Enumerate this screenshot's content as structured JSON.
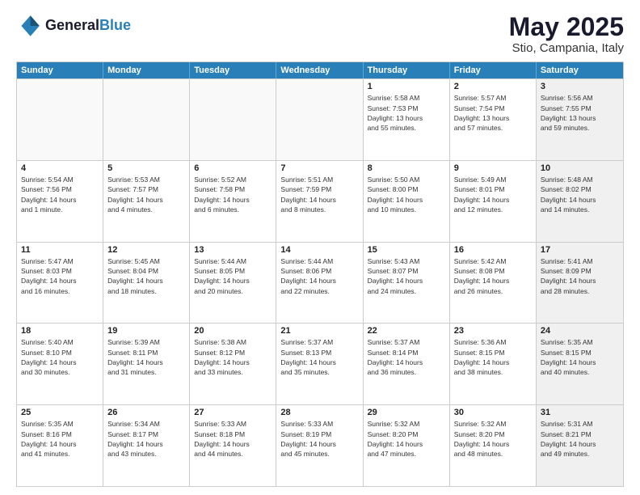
{
  "logo": {
    "line1": "General",
    "line2": "Blue"
  },
  "title": "May 2025",
  "subtitle": "Stio, Campania, Italy",
  "days": [
    "Sunday",
    "Monday",
    "Tuesday",
    "Wednesday",
    "Thursday",
    "Friday",
    "Saturday"
  ],
  "weeks": [
    [
      {
        "day": "",
        "empty": true
      },
      {
        "day": "",
        "empty": true
      },
      {
        "day": "",
        "empty": true
      },
      {
        "day": "",
        "empty": true
      },
      {
        "day": "1",
        "info": "Sunrise: 5:58 AM\nSunset: 7:53 PM\nDaylight: 13 hours\nand 55 minutes."
      },
      {
        "day": "2",
        "info": "Sunrise: 5:57 AM\nSunset: 7:54 PM\nDaylight: 13 hours\nand 57 minutes."
      },
      {
        "day": "3",
        "info": "Sunrise: 5:56 AM\nSunset: 7:55 PM\nDaylight: 13 hours\nand 59 minutes.",
        "shaded": true
      }
    ],
    [
      {
        "day": "4",
        "info": "Sunrise: 5:54 AM\nSunset: 7:56 PM\nDaylight: 14 hours\nand 1 minute."
      },
      {
        "day": "5",
        "info": "Sunrise: 5:53 AM\nSunset: 7:57 PM\nDaylight: 14 hours\nand 4 minutes."
      },
      {
        "day": "6",
        "info": "Sunrise: 5:52 AM\nSunset: 7:58 PM\nDaylight: 14 hours\nand 6 minutes."
      },
      {
        "day": "7",
        "info": "Sunrise: 5:51 AM\nSunset: 7:59 PM\nDaylight: 14 hours\nand 8 minutes."
      },
      {
        "day": "8",
        "info": "Sunrise: 5:50 AM\nSunset: 8:00 PM\nDaylight: 14 hours\nand 10 minutes."
      },
      {
        "day": "9",
        "info": "Sunrise: 5:49 AM\nSunset: 8:01 PM\nDaylight: 14 hours\nand 12 minutes."
      },
      {
        "day": "10",
        "info": "Sunrise: 5:48 AM\nSunset: 8:02 PM\nDaylight: 14 hours\nand 14 minutes.",
        "shaded": true
      }
    ],
    [
      {
        "day": "11",
        "info": "Sunrise: 5:47 AM\nSunset: 8:03 PM\nDaylight: 14 hours\nand 16 minutes."
      },
      {
        "day": "12",
        "info": "Sunrise: 5:45 AM\nSunset: 8:04 PM\nDaylight: 14 hours\nand 18 minutes."
      },
      {
        "day": "13",
        "info": "Sunrise: 5:44 AM\nSunset: 8:05 PM\nDaylight: 14 hours\nand 20 minutes."
      },
      {
        "day": "14",
        "info": "Sunrise: 5:44 AM\nSunset: 8:06 PM\nDaylight: 14 hours\nand 22 minutes."
      },
      {
        "day": "15",
        "info": "Sunrise: 5:43 AM\nSunset: 8:07 PM\nDaylight: 14 hours\nand 24 minutes."
      },
      {
        "day": "16",
        "info": "Sunrise: 5:42 AM\nSunset: 8:08 PM\nDaylight: 14 hours\nand 26 minutes."
      },
      {
        "day": "17",
        "info": "Sunrise: 5:41 AM\nSunset: 8:09 PM\nDaylight: 14 hours\nand 28 minutes.",
        "shaded": true
      }
    ],
    [
      {
        "day": "18",
        "info": "Sunrise: 5:40 AM\nSunset: 8:10 PM\nDaylight: 14 hours\nand 30 minutes."
      },
      {
        "day": "19",
        "info": "Sunrise: 5:39 AM\nSunset: 8:11 PM\nDaylight: 14 hours\nand 31 minutes."
      },
      {
        "day": "20",
        "info": "Sunrise: 5:38 AM\nSunset: 8:12 PM\nDaylight: 14 hours\nand 33 minutes."
      },
      {
        "day": "21",
        "info": "Sunrise: 5:37 AM\nSunset: 8:13 PM\nDaylight: 14 hours\nand 35 minutes."
      },
      {
        "day": "22",
        "info": "Sunrise: 5:37 AM\nSunset: 8:14 PM\nDaylight: 14 hours\nand 36 minutes."
      },
      {
        "day": "23",
        "info": "Sunrise: 5:36 AM\nSunset: 8:15 PM\nDaylight: 14 hours\nand 38 minutes."
      },
      {
        "day": "24",
        "info": "Sunrise: 5:35 AM\nSunset: 8:15 PM\nDaylight: 14 hours\nand 40 minutes.",
        "shaded": true
      }
    ],
    [
      {
        "day": "25",
        "info": "Sunrise: 5:35 AM\nSunset: 8:16 PM\nDaylight: 14 hours\nand 41 minutes."
      },
      {
        "day": "26",
        "info": "Sunrise: 5:34 AM\nSunset: 8:17 PM\nDaylight: 14 hours\nand 43 minutes."
      },
      {
        "day": "27",
        "info": "Sunrise: 5:33 AM\nSunset: 8:18 PM\nDaylight: 14 hours\nand 44 minutes."
      },
      {
        "day": "28",
        "info": "Sunrise: 5:33 AM\nSunset: 8:19 PM\nDaylight: 14 hours\nand 45 minutes."
      },
      {
        "day": "29",
        "info": "Sunrise: 5:32 AM\nSunset: 8:20 PM\nDaylight: 14 hours\nand 47 minutes."
      },
      {
        "day": "30",
        "info": "Sunrise: 5:32 AM\nSunset: 8:20 PM\nDaylight: 14 hours\nand 48 minutes."
      },
      {
        "day": "31",
        "info": "Sunrise: 5:31 AM\nSunset: 8:21 PM\nDaylight: 14 hours\nand 49 minutes.",
        "shaded": true
      }
    ]
  ]
}
